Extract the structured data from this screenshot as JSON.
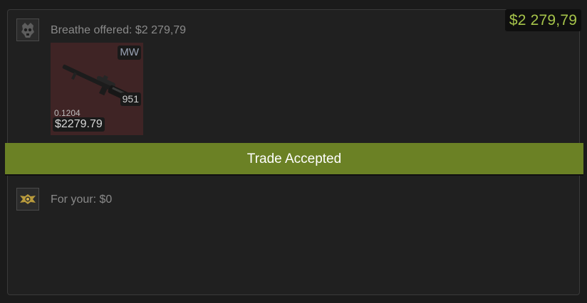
{
  "trade": {
    "total_value": "$2 279,79",
    "status_text": "Trade Accepted",
    "status_color": "#6b8125",
    "accent_color": "#a6c44a"
  },
  "them": {
    "offer_label": "Breathe offered: $2 279,79",
    "avatar_icon": "skull-avatar-icon",
    "items": [
      {
        "weapon_icon": "sniper-rifle-icon",
        "wear": "MW",
        "count": "951",
        "float": "0.1204",
        "price": "$2279.79",
        "card_color": "#3f2425"
      }
    ]
  },
  "you": {
    "offer_label": "For your: $0",
    "avatar_icon": "gold-emblem-avatar-icon"
  }
}
